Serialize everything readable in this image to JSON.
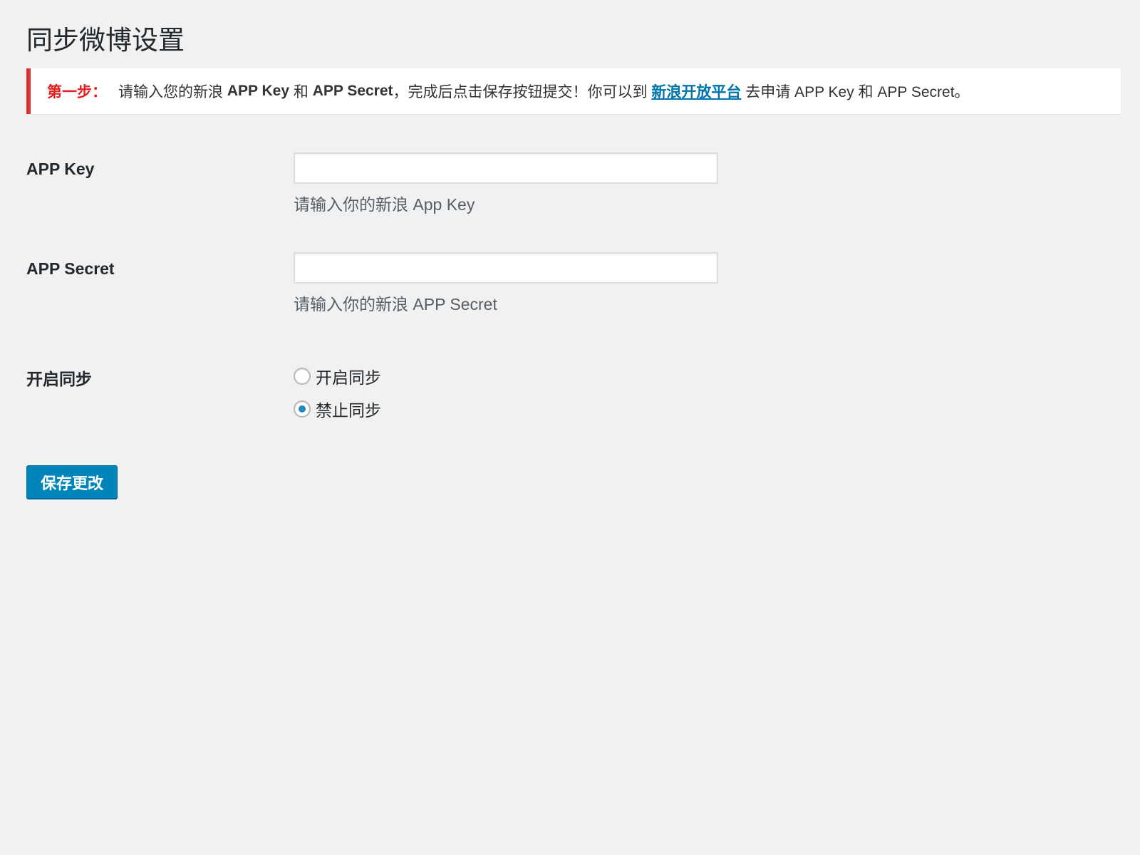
{
  "page": {
    "title": "同步微博设置"
  },
  "notice": {
    "step_label": "第一步：",
    "text_1": "请输入您的新浪 ",
    "bold_app_key": "APP Key",
    "text_2": " 和 ",
    "bold_app_secret": "APP Secret",
    "text_3": "，完成后点击保存按钮提交！你可以到 ",
    "link_text": "新浪开放平台",
    "text_4": " 去申请 APP Key 和 APP Secret。"
  },
  "fields": {
    "app_key": {
      "label": "APP Key",
      "value": "",
      "description": "请输入你的新浪 App Key"
    },
    "app_secret": {
      "label": "APP Secret",
      "value": "",
      "description": "请输入你的新浪 APP Secret"
    },
    "sync": {
      "label": "开启同步",
      "options": [
        {
          "label": "开启同步",
          "checked": false
        },
        {
          "label": "禁止同步",
          "checked": true
        }
      ]
    }
  },
  "submit": {
    "label": "保存更改"
  },
  "colors": {
    "background": "#f1f1f1",
    "notice_border": "#dc3232",
    "step_label": "#e02020",
    "link": "#0073aa",
    "button": "#0085ba",
    "radio_dot": "#1e8cbe"
  }
}
